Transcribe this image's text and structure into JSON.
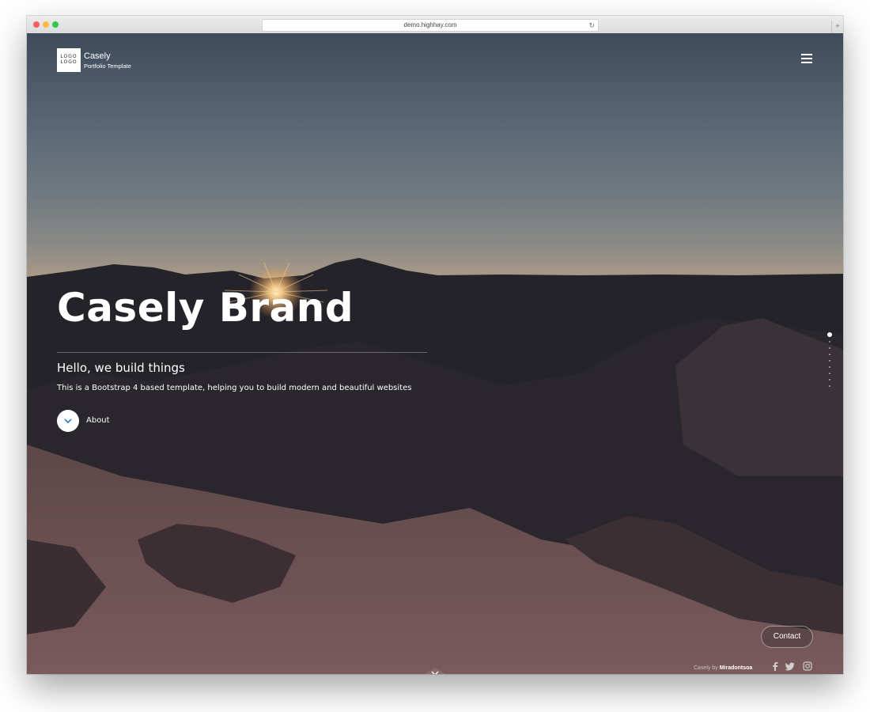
{
  "browser": {
    "url": "demo.highhay.com"
  },
  "header": {
    "logo_text": "LOGO LOGO",
    "brand_name": "Casely",
    "brand_subtitle": "Portfolio Template"
  },
  "hero": {
    "title": "Casely Brand",
    "subtitle": "Hello, we build things",
    "description": "This is a Bootstrap 4 based template, helping you to build modern and beautiful websites",
    "about_label": "About"
  },
  "side_nav": {
    "dots": [
      true,
      false,
      false,
      false,
      false,
      false,
      false,
      false,
      false
    ]
  },
  "footer": {
    "contact_label": "Contact",
    "credit_prefix": "Casely by",
    "credit_author": "Miradontsoa",
    "social_icons": [
      "facebook-icon",
      "twitter-icon",
      "instagram-icon"
    ]
  },
  "colors": {
    "text": "#ffffff",
    "sky_top": "#3e4b5a",
    "horizon": "#d8a477",
    "traffic_red": "#fc605c",
    "traffic_yellow": "#fdbc40",
    "traffic_green": "#34c84a"
  }
}
